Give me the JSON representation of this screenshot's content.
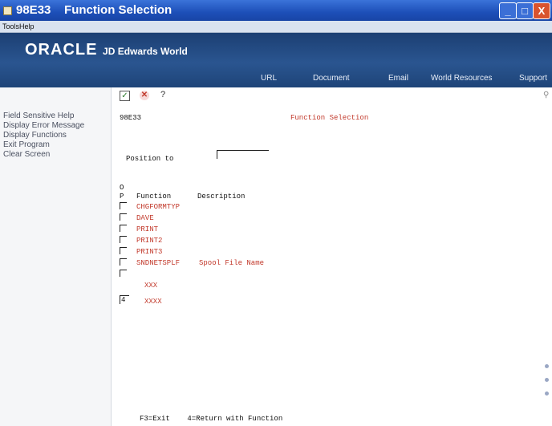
{
  "window": {
    "title": "98E33    Function Selection",
    "buttons": [
      "_",
      "□",
      "X"
    ]
  },
  "menubar": {
    "items": [
      "Tools",
      "Help"
    ]
  },
  "banner": {
    "brand": "ORACLE",
    "product": "JD Edwards World",
    "nav": [
      "URL",
      "Document",
      "Email",
      "World Resources",
      "Support"
    ]
  },
  "sidebar": {
    "items": [
      "Field Sensitive Help",
      "Display Error Message",
      "Display Functions",
      "Exit Program",
      "Clear Screen"
    ]
  },
  "toolbar": {
    "check": "✓",
    "cancel": "✕",
    "help": "?"
  },
  "screen": {
    "program_id": "98E33",
    "title": "Function Selection",
    "position_label": "Position to",
    "position_value": "",
    "header_o": "O",
    "header_p": "P",
    "col_function": "Function",
    "col_description": "Description",
    "rows": [
      {
        "option": "",
        "function": "CHGFORMTYP",
        "description": ""
      },
      {
        "option": "",
        "function": "DAVE",
        "description": ""
      },
      {
        "option": "",
        "function": "PRINT",
        "description": ""
      },
      {
        "option": "",
        "function": "PRINT2",
        "description": ""
      },
      {
        "option": "",
        "function": "PRINT3",
        "description": ""
      },
      {
        "option": "",
        "function": "SNDNETSPLF",
        "description": "Spool File Name"
      },
      {
        "option": "",
        "function": "XXX",
        "description": ""
      },
      {
        "option": "4",
        "function": "XXXX",
        "description": ""
      }
    ],
    "footer_keys": "F3=Exit    4=Return with Function"
  }
}
